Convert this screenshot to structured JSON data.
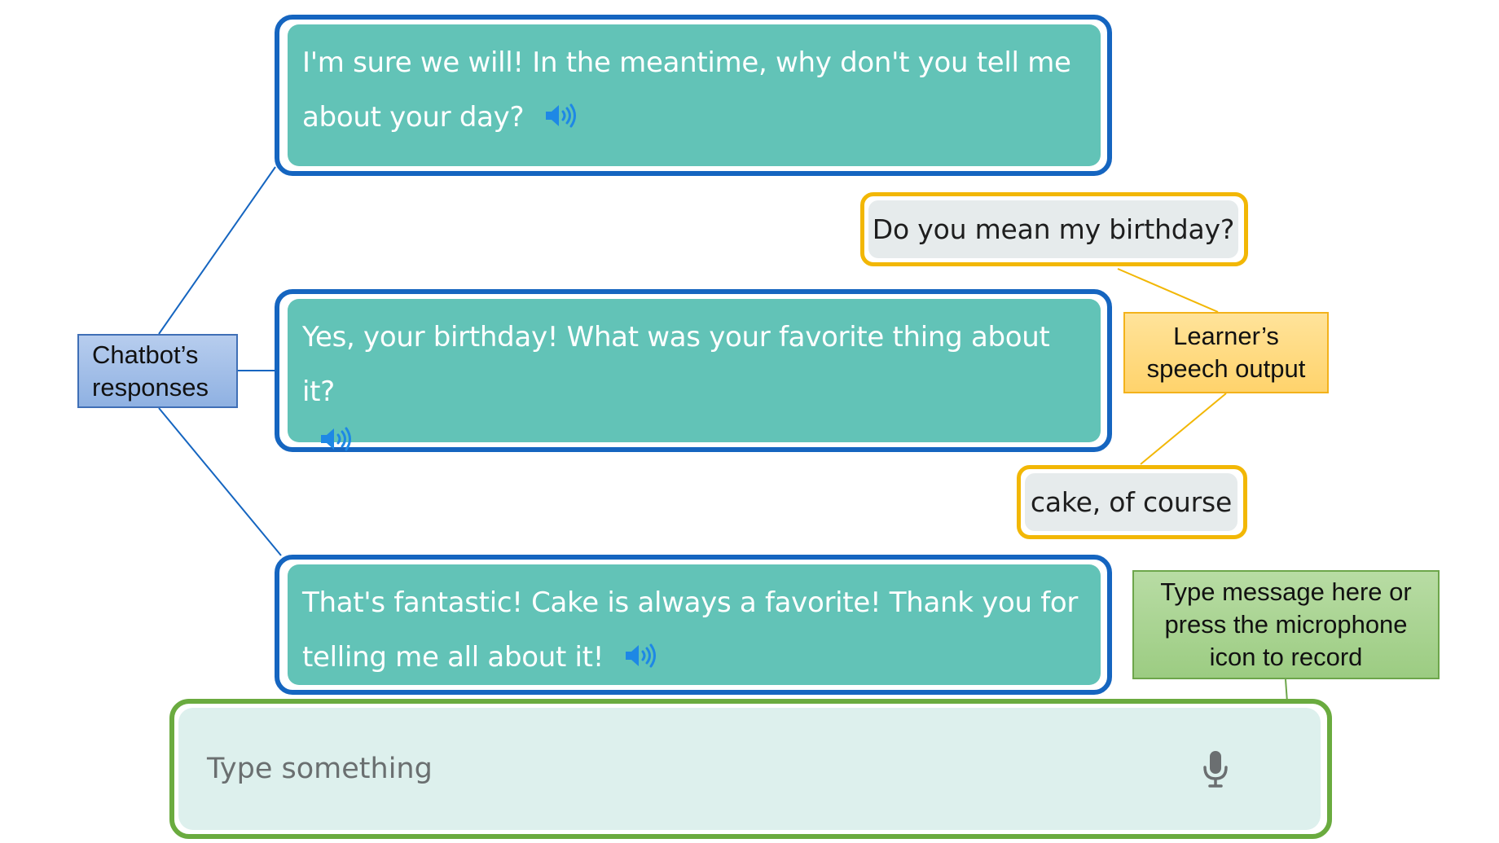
{
  "chatbot_messages": [
    {
      "line1": "I'm sure we will! In the meantime, why don't you tell me",
      "line2": "about your day?"
    },
    {
      "line1": "Yes, your birthday! What was your favorite thing about it?",
      "line2": ""
    },
    {
      "line1": "That's fantastic! Cake is always a favorite! Thank you for",
      "line2": "telling me all about it!"
    }
  ],
  "learner_messages": [
    {
      "text": "Do you mean my birthday?"
    },
    {
      "text": "cake, of course"
    }
  ],
  "callouts": {
    "chatbot": {
      "line1": "Chatbot’s",
      "line2": "responses"
    },
    "learner": {
      "line1": "Learner’s",
      "line2": "speech output"
    },
    "input": {
      "line1": "Type message here or",
      "line2": "press the microphone",
      "line3": "icon to record"
    }
  },
  "input": {
    "placeholder": "Type something"
  },
  "icons": {
    "speaker": "speaker-icon",
    "microphone": "microphone-icon"
  },
  "colors": {
    "chatbot_border": "#1565c0",
    "chatbot_bubble": "#62c3b7",
    "learner_border": "#f2b705",
    "learner_bubble": "#e6ebec",
    "input_border": "#6aab3f",
    "input_fill": "#ddf0ed",
    "speaker_icon": "#1e88e5"
  }
}
